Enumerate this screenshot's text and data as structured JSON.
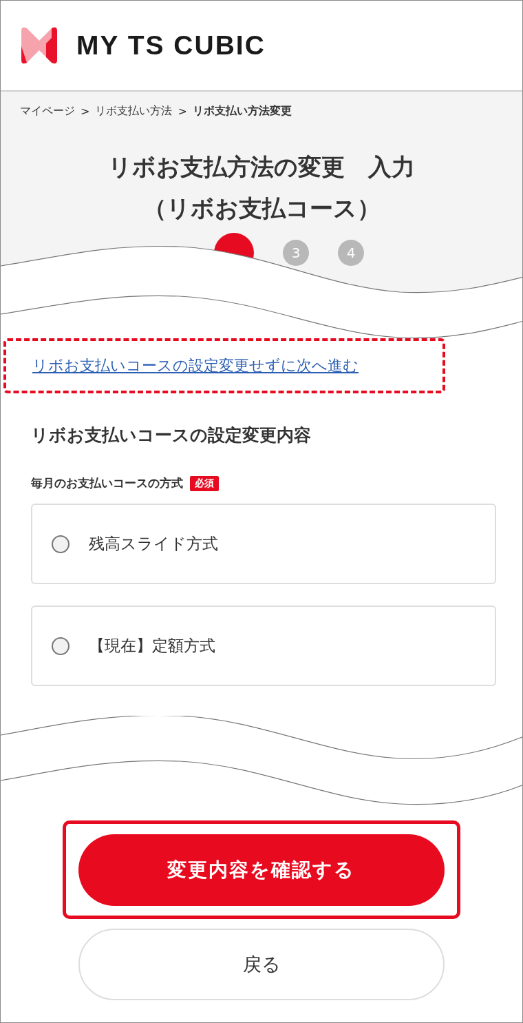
{
  "header": {
    "logo_text": "MY TS CUBIC"
  },
  "breadcrumb": {
    "separator": ">",
    "items": [
      {
        "label": "マイページ",
        "current": false
      },
      {
        "label": "リボ支払い方法",
        "current": false
      },
      {
        "label": "リボ支払い方法変更",
        "current": true
      }
    ]
  },
  "title_lines": [
    "リボお支払方法の変更　入力",
    "（リボお支払コース）"
  ],
  "steps": [
    {
      "selected": true
    },
    {
      "label": "3",
      "selected": false
    },
    {
      "label": "4",
      "selected": false
    }
  ],
  "skip_link": "リボお支払いコースの設定変更せずに次へ進む",
  "section_title": "リボお支払いコースの設定変更内容",
  "field": {
    "label": "毎月のお支払いコースの方式",
    "badge": "必須",
    "options": [
      {
        "label": "残高スライド方式",
        "selected": false
      },
      {
        "label": "【現在】定額方式",
        "selected": false
      }
    ]
  },
  "buttons": {
    "primary": "変更内容を確認する",
    "secondary": "戻る"
  }
}
